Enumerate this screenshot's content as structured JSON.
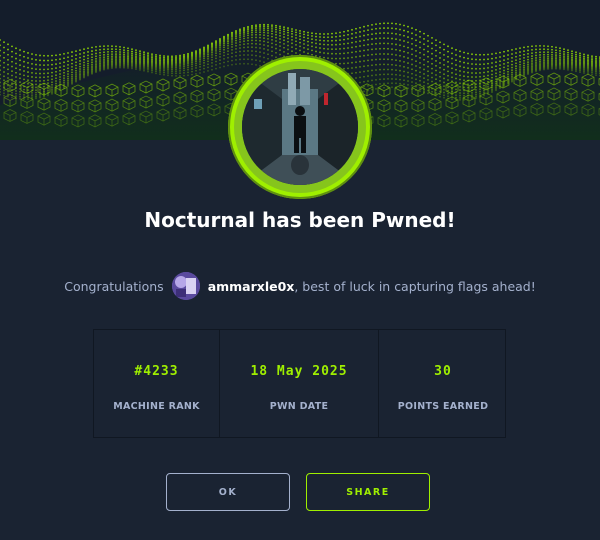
{
  "banner": {
    "accent": "#9fef00"
  },
  "machine": {
    "avatar": "machine-avatar",
    "title": "Nocturnal has been Pwned!"
  },
  "message": {
    "prefix": "Congratulations",
    "username": "ammarxle0x",
    "suffix": ", best of luck in capturing flags ahead!"
  },
  "stats": [
    {
      "value": "#4233",
      "label": "MACHINE RANK"
    },
    {
      "value": "18 May 2025",
      "label": "PWN DATE"
    },
    {
      "value": "30",
      "label": "POINTS EARNED"
    }
  ],
  "buttons": {
    "ok": "OK",
    "share": "SHARE"
  },
  "colors": {
    "background": "#1a2332",
    "accent": "#9fef00",
    "muted": "#a4b1cd"
  }
}
